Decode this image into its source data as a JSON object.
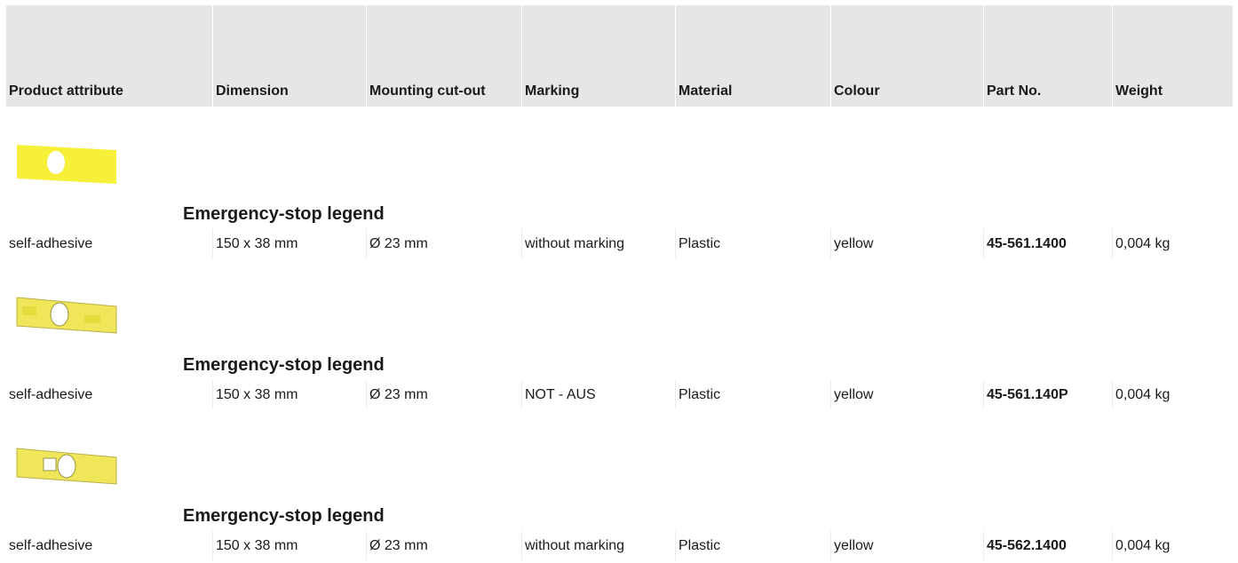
{
  "table": {
    "headers": [
      "Product attribute",
      "Dimension",
      "Mounting cut-out",
      "Marking",
      "Material",
      "Colour",
      "Part No.",
      "Weight"
    ]
  },
  "products": [
    {
      "title": "Emergency-stop legend",
      "image_icon": "yellow-legend-plate-round-hole",
      "row": [
        "self-adhesive",
        "150 x 38 mm",
        "Ø 23 mm",
        "without marking",
        "Plastic",
        "yellow",
        "45-561.1400",
        "0,004 kg"
      ]
    },
    {
      "title": "Emergency-stop legend",
      "image_icon": "yellow-legend-plate-notaus",
      "row": [
        "self-adhesive",
        "150 x 38 mm",
        "Ø 23 mm",
        "NOT - AUS",
        "Plastic",
        "yellow",
        "45-561.140P",
        "0,004 kg"
      ]
    },
    {
      "title": "Emergency-stop legend",
      "image_icon": "yellow-legend-plate-square-and-round-hole",
      "row": [
        "self-adhesive",
        "150 x 38 mm",
        "Ø 23 mm",
        "without marking",
        "Plastic",
        "yellow",
        "45-562.1400",
        "0,004 kg"
      ]
    }
  ],
  "colors": {
    "header_bg": "#e6e6e6",
    "row_divider": "#ececec",
    "plate_yellow": "#f5ee3a",
    "text": "#1a1a1a"
  }
}
